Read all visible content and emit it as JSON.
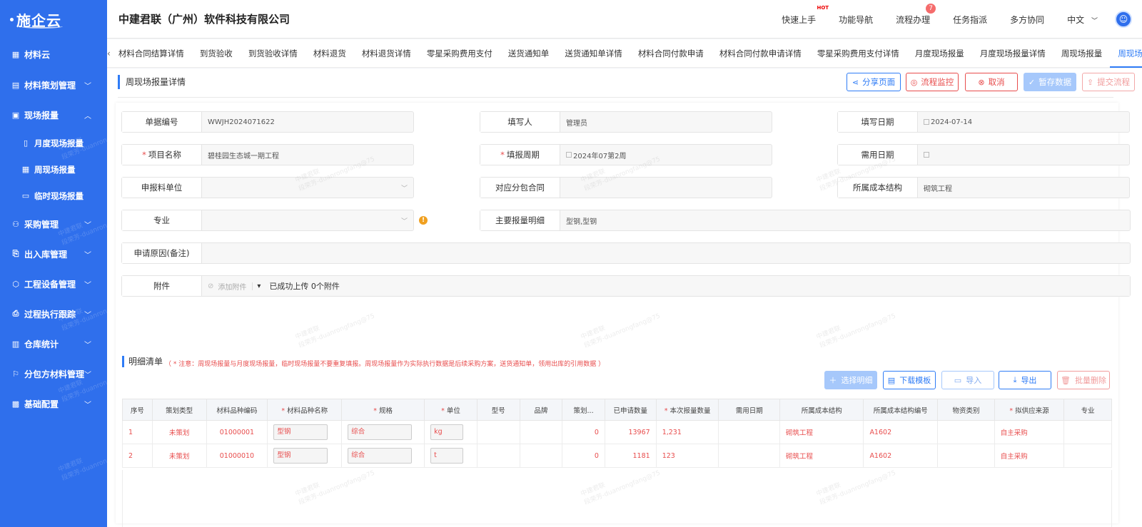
{
  "sidebar": {
    "logo": "施企云",
    "items": [
      {
        "label": "材料云",
        "icon": "grid-icon"
      },
      {
        "label": "材料策划管理",
        "icon": "plan-icon"
      },
      {
        "label": "现场报量",
        "icon": "report-icon"
      },
      {
        "label": "月度现场报量",
        "icon": "doc-icon"
      },
      {
        "label": "周现场报量",
        "icon": "calendar-icon"
      },
      {
        "label": "临时现场报量",
        "icon": "temp-icon"
      },
      {
        "label": "采购管理",
        "icon": "purchase-icon"
      },
      {
        "label": "出入库管理",
        "icon": "warehouse-icon"
      },
      {
        "label": "工程设备管理",
        "icon": "equipment-icon"
      },
      {
        "label": "过程执行跟踪",
        "icon": "track-icon"
      },
      {
        "label": "仓库统计",
        "icon": "stats-icon"
      },
      {
        "label": "分包方材料管理",
        "icon": "subcontract-icon"
      },
      {
        "label": "基础配置",
        "icon": "config-icon"
      }
    ]
  },
  "header": {
    "company": "中建君联（广州）软件科技有限公司",
    "quick_start": "快速上手",
    "hot": "HOT",
    "func_nav": "功能导航",
    "flow": "流程办理",
    "flow_badge": "7",
    "task": "任务指派",
    "collab": "多方协同",
    "lang": "中文"
  },
  "tabs": [
    "材料合同结算详情",
    "到货验收",
    "到货验收详情",
    "材料退货",
    "材料退货详情",
    "零星采购费用支付",
    "送货通知单",
    "送货通知单详情",
    "材料合同付款申请",
    "材料合同付款申请详情",
    "零星采购费用支付详情",
    "月度现场报量",
    "月度现场报量详情",
    "周现场报量",
    "周现场报量详情"
  ],
  "page": {
    "title": "周现场报量详情",
    "buttons": {
      "share": "分享页面",
      "monitor": "流程监控",
      "cancel": "取消",
      "save": "暂存数据",
      "submit": "提交流程"
    }
  },
  "form": {
    "doc_no_label": "单据编号",
    "doc_no": "WWJH2024071622",
    "filler_label": "填写人",
    "filler": "管理员",
    "fill_date_label": "填写日期",
    "fill_date": "2024-07-14",
    "project_label": "项目名称",
    "project": "碧桂园生态城一期工程",
    "period_label": "填报周期",
    "period": "2024年07第2周",
    "need_date_label": "需用日期",
    "need_date": "",
    "unit_label": "申报料单位",
    "unit": "",
    "contract_label": "对应分包合同",
    "contract": "",
    "cost_label": "所属成本结构",
    "cost": "砌筑工程",
    "major_label": "专业",
    "major": "",
    "detail_label": "主要报量明细",
    "detail": "型钢,型钢",
    "reason_label": "申请原因(备注)",
    "reason": "",
    "attach_label": "附件",
    "attach_add": "添加附件",
    "attach_status": "已成功上传 0个附件"
  },
  "detail": {
    "title": "明细清单",
    "note": "（ * 注意：周现场报量与月度现场报量，临时现场报量不要重复填报。周现场报量作为实际执行数据是后续采购方案，送货通知单，领用出库的引用数据 ）",
    "buttons": {
      "select": "选择明细",
      "download": "下载模板",
      "import": "导入",
      "export": "导出",
      "batch_delete": "批量删除"
    },
    "columns": [
      "序号",
      "策划类型",
      "材料品种编码",
      "材料品种名称",
      "规格",
      "单位",
      "型号",
      "品牌",
      "策划...",
      "已申请数量",
      "本次报量数量",
      "需用日期",
      "所属成本结构",
      "所属成本结构编号",
      "物资类别",
      "拟供应来源",
      "专业"
    ],
    "rows": [
      {
        "no": "1",
        "type": "未策划",
        "code": "01000001",
        "name": "型钢",
        "spec": "综合",
        "unit": "kg",
        "model": "",
        "brand": "",
        "plan": "0",
        "applied": "13967",
        "qty": "1,231",
        "date": "",
        "cost": "砌筑工程",
        "cost_no": "A1602",
        "category": "",
        "source": "自主采购",
        "major": ""
      },
      {
        "no": "2",
        "type": "未策划",
        "code": "01000010",
        "name": "型钢",
        "spec": "综合",
        "unit": "t",
        "model": "",
        "brand": "",
        "plan": "0",
        "applied": "1181",
        "qty": "123",
        "date": "",
        "cost": "砌筑工程",
        "cost_no": "A1602",
        "category": "",
        "source": "自主采购",
        "major": ""
      }
    ]
  },
  "watermark": {
    "line1": "中建君联",
    "line2": "段荣芳-duanrongfang@75"
  },
  "colors": {
    "primary": "#2f7cf6",
    "sidebar": "#2f6fec",
    "danger": "#e84d4d"
  }
}
